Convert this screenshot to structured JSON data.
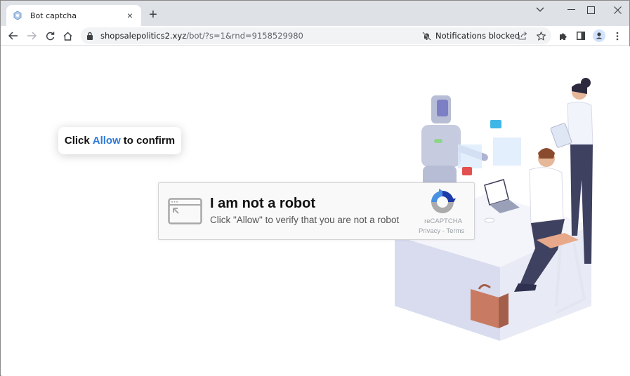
{
  "browser": {
    "tab": {
      "title": "Bot captcha",
      "close_label": "×",
      "favicon": "bot-favicon-icon"
    },
    "new_tab_label": "+",
    "window_controls": {
      "tab_search": "chevron-down-icon",
      "minimize": "minimize-icon",
      "maximize": "maximize-icon",
      "close": "close-icon"
    },
    "toolbar": {
      "back": "back-arrow-icon",
      "forward": "forward-arrow-icon",
      "reload": "reload-icon",
      "home": "home-icon",
      "url_host": "shopsalepolitics2.xyz",
      "url_path": "/bot/?s=1&rnd=9158529980",
      "notifications_status": "Notifications blocked",
      "share": "share-icon",
      "bookmark": "star-icon",
      "extensions": "puzzle-icon",
      "side_panel": "side-panel-icon",
      "profile": "profile-avatar-icon",
      "menu": "kebab-menu-icon"
    }
  },
  "page": {
    "confirm_card": {
      "prefix": "Click",
      "highlight": "Allow",
      "suffix": "to confirm",
      "highlight_color": "#2f7ad8"
    },
    "captcha": {
      "title": "I am not a robot",
      "subtitle": "Click \"Allow\" to verify that you are not a robot",
      "brand": "reCAPTCHA",
      "links": "Privacy - Terms"
    },
    "illustration": "robot-and-office-workers-illustration"
  }
}
